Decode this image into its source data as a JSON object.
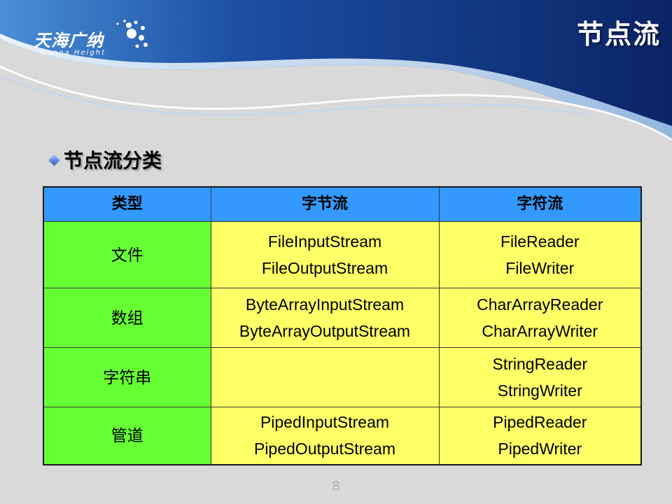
{
  "logo": {
    "cn": "天海广纳",
    "en": "Gonna Height"
  },
  "slide": {
    "title": "节点流",
    "section_heading": "节点流分类",
    "page_number": "8"
  },
  "colors": {
    "header_blue_dark": "#0d2a6b",
    "header_blue_light": "#3a8de0",
    "table_header": "#3399ff",
    "type_column": "#66ff33",
    "data_cells": "#ffff66",
    "background": "#d9d9d9"
  },
  "table": {
    "headers": [
      "类型",
      "字节流",
      "字符流"
    ],
    "rows": [
      {
        "type": "文件",
        "byte": [
          "FileInputStream",
          "FileOutputStream"
        ],
        "char": [
          "FileReader",
          "FileWriter"
        ]
      },
      {
        "type": "数组",
        "byte": [
          "ByteArrayInputStream",
          "ByteArrayOutputStream"
        ],
        "char": [
          "CharArrayReader",
          "CharArrayWriter"
        ]
      },
      {
        "type": "字符串",
        "byte": [
          "",
          ""
        ],
        "char": [
          "StringReader",
          "StringWriter"
        ]
      },
      {
        "type": "管道",
        "byte": [
          "PipedInputStream",
          "PipedOutputStream"
        ],
        "char": [
          "PipedReader",
          "PipedWriter"
        ]
      }
    ]
  }
}
